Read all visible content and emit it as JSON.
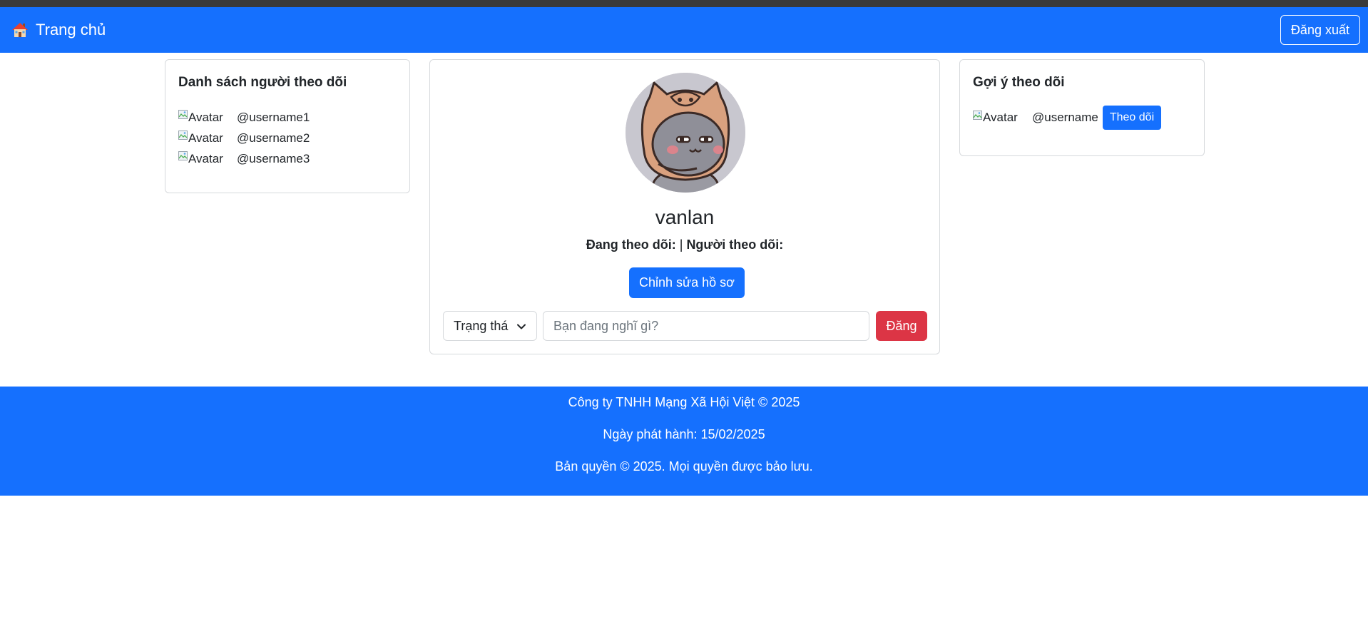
{
  "navbar": {
    "brand_label": "Trang chủ",
    "brand_icon": "house-icon",
    "logout_label": "Đăng xuất",
    "accent_color": "#1570fe"
  },
  "followers": {
    "title": "Danh sách người theo dõi",
    "items": [
      {
        "avatar_alt": "Avatar",
        "username": "@username1"
      },
      {
        "avatar_alt": "Avatar",
        "username": "@username2"
      },
      {
        "avatar_alt": "Avatar",
        "username": "@username3"
      }
    ]
  },
  "profile": {
    "name": "vanlan",
    "following_label": "Đang theo dõi:",
    "separator": "|",
    "followers_label": "Người theo dõi:",
    "edit_label": "Chỉnh sửa hồ sơ"
  },
  "composer": {
    "status_selected": "Trạng thá",
    "input_placeholder": "Bạn đang nghĩ gì?",
    "post_label": "Đăng",
    "post_color": "#dc3545"
  },
  "suggestions": {
    "title": "Gợi ý theo dõi",
    "items": [
      {
        "avatar_alt": "Avatar",
        "username": "@username",
        "follow_label": "Theo dõi"
      }
    ]
  },
  "footer": {
    "company": "Công ty TNHH Mạng Xã Hội Việt © 2025",
    "release": "Ngày phát hành: 15/02/2025",
    "copyright": "Bản quyền © 2025. Mọi quyền được bảo lưu."
  }
}
